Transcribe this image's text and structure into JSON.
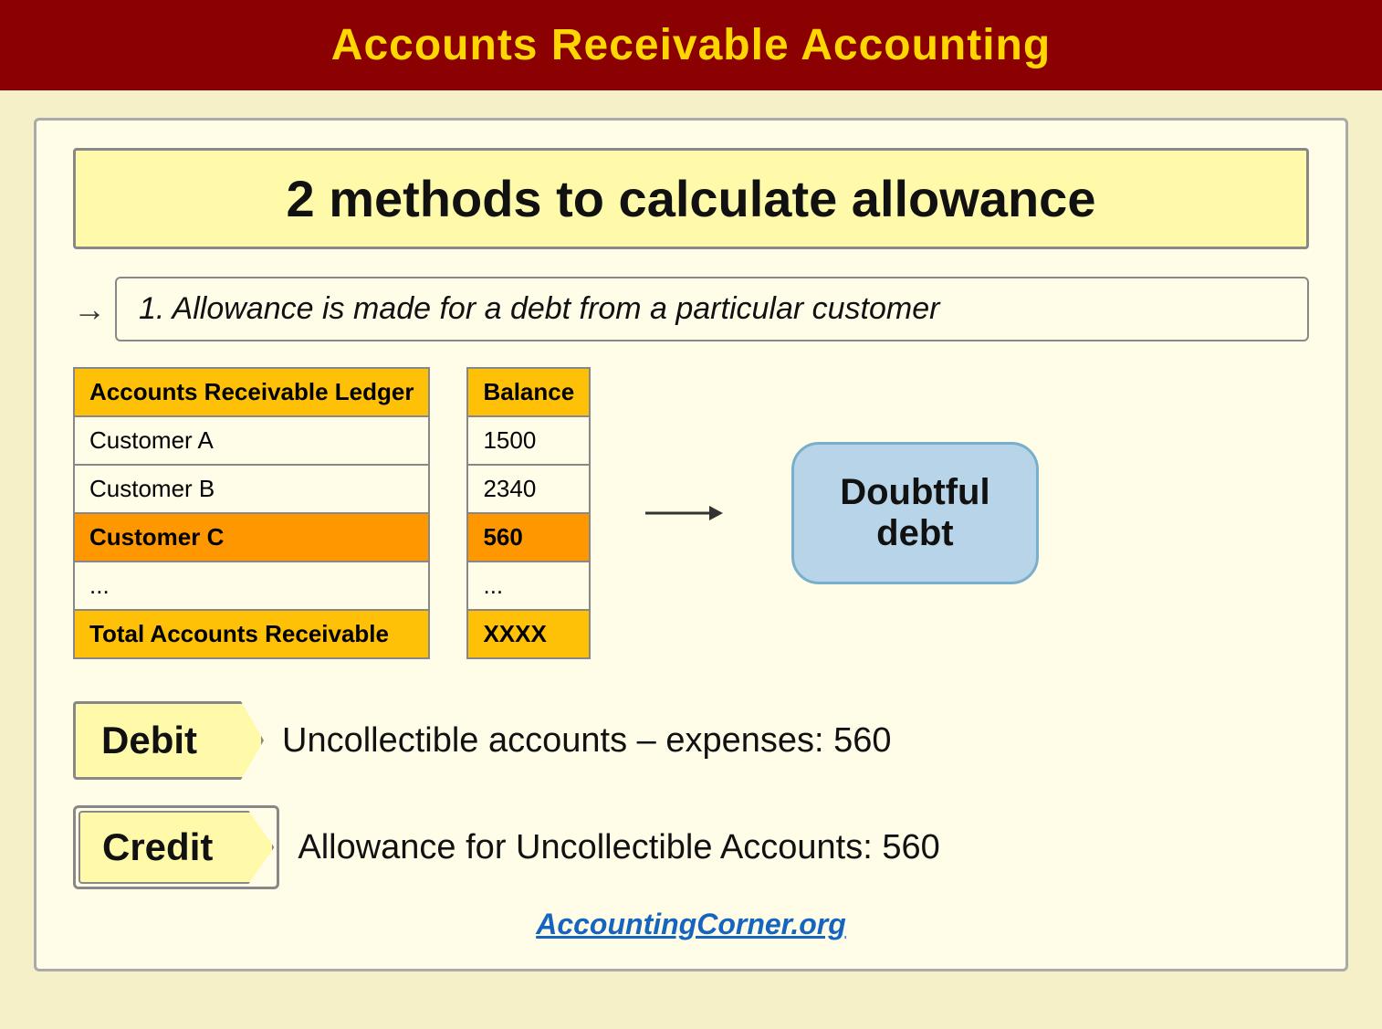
{
  "header": {
    "title": "Accounts Receivable Accounting",
    "bg_color": "#8b0000",
    "text_color": "#ffd700"
  },
  "methods_title": "2 methods to calculate allowance",
  "method1": {
    "arrow": "→",
    "text": "1. Allowance is made for a debt from a particular customer"
  },
  "ledger_table": {
    "header": "Accounts Receivable Ledger",
    "rows": [
      {
        "label": "Customer A",
        "style": "white"
      },
      {
        "label": "Customer B",
        "style": "white"
      },
      {
        "label": "Customer C",
        "style": "orange"
      },
      {
        "label": "...",
        "style": "light"
      },
      {
        "label": "Total Accounts Receivable",
        "style": "total"
      }
    ]
  },
  "balance_table": {
    "header": "Balance",
    "rows": [
      {
        "value": "1500",
        "style": "white"
      },
      {
        "value": "2340",
        "style": "white"
      },
      {
        "value": "560",
        "style": "orange"
      },
      {
        "value": "...",
        "style": "light"
      },
      {
        "value": "XXXX",
        "style": "total"
      }
    ]
  },
  "doubtful_debt": {
    "line1": "Doubtful",
    "line2": "debt"
  },
  "debit": {
    "label": "Debit",
    "text": "Uncollectible accounts – expenses: 560"
  },
  "credit": {
    "label": "Credit",
    "text": "Allowance for Uncollectible Accounts: 560"
  },
  "footer": {
    "link_text": "AccountingCorner.org",
    "link_url": "https://www.accountingcorner.org"
  }
}
